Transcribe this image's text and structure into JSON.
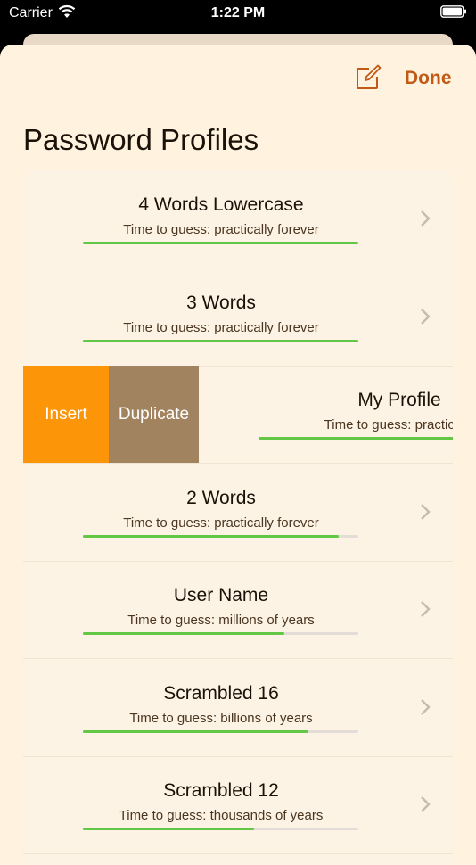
{
  "status": {
    "carrier": "Carrier",
    "time": "1:22 PM"
  },
  "header": {
    "done_label": "Done",
    "title": "Password Profiles"
  },
  "actions": {
    "insert_label": "Insert",
    "duplicate_label": "Duplicate"
  },
  "colors": {
    "accent": "#c15a17",
    "strength_bar": "#62c745",
    "insert": "#fc9508",
    "duplicate": "#a2835f"
  },
  "profiles": [
    {
      "name": "4 Words Lowercase",
      "time": "Time to guess: practically forever",
      "strength": 1.0
    },
    {
      "name": "3 Words",
      "time": "Time to guess: practically forever",
      "strength": 1.0
    },
    {
      "name": "My Profile",
      "time": "Time to guess: practically",
      "strength": 1.0
    },
    {
      "name": "2 Words",
      "time": "Time to guess: practically forever",
      "strength": 0.93
    },
    {
      "name": "User Name",
      "time": "Time to guess: millions of years",
      "strength": 0.73
    },
    {
      "name": "Scrambled 16",
      "time": "Time to guess: billions of years",
      "strength": 0.82
    },
    {
      "name": "Scrambled 12",
      "time": "Time to guess: thousands of years",
      "strength": 0.62
    }
  ]
}
